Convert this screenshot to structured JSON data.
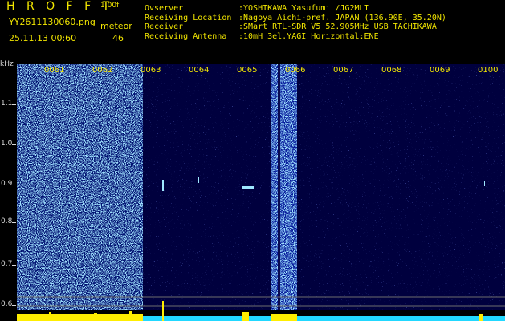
{
  "header": {
    "app_title": "H R O F F T",
    "version": "1.00f",
    "filename": "YY2611130060.png",
    "datetime": "25.11.13 00:60",
    "meteor_label": "meteor",
    "meteor_count": "46"
  },
  "info": [
    {
      "key": "Ovserver",
      "value": ":YOSHIKAWA Yasufumi /JG2MLI"
    },
    {
      "key": "Receiving Location",
      "value": ":Nagoya Aichi-pref. JAPAN (136.90E, 35.20N)"
    },
    {
      "key": "Receiver",
      "value": ":SMart RTL-SDR V5 52.905MHz USB TACHIKAWA"
    },
    {
      "key": "Receiving Antenna",
      "value": ":10mH 3el.YAGI Horizontal:ENE"
    }
  ],
  "axis": {
    "unit": "kHz",
    "y_labels": [
      "1.1",
      "1.0",
      "0.9",
      "0.8",
      "0.7",
      "0.6"
    ],
    "x_labels": [
      "0061",
      "0062",
      "0063",
      "0064",
      "0065",
      "0066",
      "0067",
      "0068",
      "0069",
      "0100"
    ]
  },
  "colors": {
    "text_yellow": "#f2e600",
    "background": "#000000",
    "spectrogram_dark": "#00004a",
    "spectrogram_noise": "#2a3bd8",
    "meteor_trace": "#9fe8ff",
    "level_bar_yellow": "#ffee00",
    "level_bar_cyan": "#22d8ff"
  }
}
